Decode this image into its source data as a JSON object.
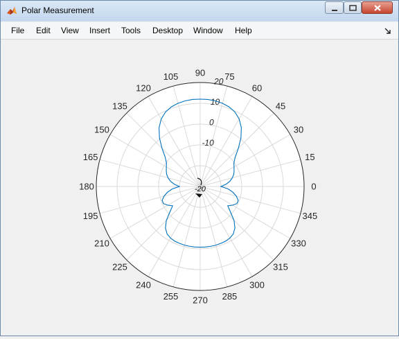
{
  "window": {
    "title": "Polar Measurement"
  },
  "menu": {
    "items": [
      "File",
      "Edit",
      "View",
      "Insert",
      "Tools",
      "Desktop",
      "Window",
      "Help"
    ]
  },
  "colors": {
    "trace": "#0072bd",
    "grid": "#d9d9d9",
    "axis_bg": "#ffffff",
    "figure_bg": "#f0f0f0"
  },
  "chart_data": {
    "type": "polar-line",
    "angle_ticks": [
      "0",
      "15",
      "30",
      "45",
      "60",
      "75",
      "90",
      "105",
      "120",
      "135",
      "150",
      "165",
      "180",
      "195",
      "210",
      "225",
      "240",
      "255",
      "270",
      "285",
      "300",
      "315",
      "330",
      "345"
    ],
    "radial_ticks": [
      "-10",
      "0",
      "10",
      "20"
    ],
    "radial_values": [
      -10,
      0,
      10,
      20
    ],
    "rlim": [
      -30,
      20
    ],
    "angle_direction": "counterclockwise",
    "zero_location": "right",
    "series": [
      {
        "angles_deg": [
          0,
          5,
          10,
          15,
          20,
          25,
          30,
          35,
          40,
          45,
          50,
          55,
          60,
          65,
          70,
          75,
          80,
          85,
          90,
          95,
          100,
          105,
          110,
          115,
          120,
          125,
          130,
          135,
          140,
          145,
          150,
          155,
          160,
          165,
          170,
          175,
          180,
          185,
          190,
          195,
          200,
          205,
          210,
          215,
          220,
          225,
          230,
          235,
          240,
          245,
          250,
          255,
          260,
          265,
          270,
          275,
          280,
          285,
          290,
          295,
          300,
          305,
          310,
          315,
          320,
          325,
          330,
          335,
          340,
          345,
          350,
          355
        ],
        "values": [
          -20.0,
          -17.5,
          -15.5,
          -14.0,
          -12.8,
          -12.0,
          -11.2,
          -10.2,
          -8.0,
          -4.0,
          0.5,
          4.5,
          7.5,
          9.5,
          10.7,
          11.4,
          11.8,
          12.0,
          12.0,
          12.0,
          11.8,
          11.4,
          10.7,
          9.5,
          7.5,
          4.5,
          0.5,
          -4.0,
          -8.0,
          -10.2,
          -11.2,
          -12.0,
          -12.8,
          -14.0,
          -15.5,
          -17.5,
          -20.0,
          -16.5,
          -14.0,
          -12.0,
          -10.5,
          -10.5,
          -12.0,
          -13.8,
          -11.0,
          -7.0,
          -4.0,
          -2.2,
          -1.4,
          -1.0,
          -0.9,
          -0.8,
          -0.8,
          -0.8,
          -0.8,
          -0.8,
          -0.8,
          -0.8,
          -0.9,
          -1.0,
          -1.4,
          -2.2,
          -4.0,
          -7.0,
          -11.0,
          -13.8,
          -12.0,
          -10.5,
          -10.5,
          -12.0,
          -14.0,
          -16.5
        ]
      }
    ]
  }
}
